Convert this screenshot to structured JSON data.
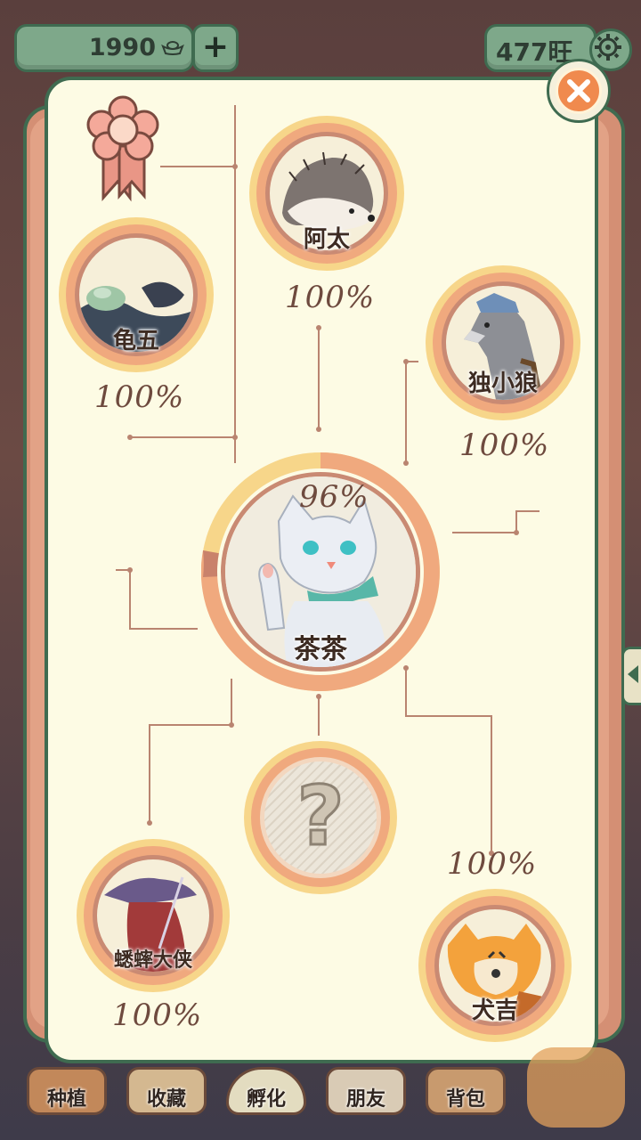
{
  "topbar": {
    "coins": "1990",
    "coin_icon": "ingot-icon",
    "plus_label": "+",
    "wang": "477旺",
    "settings_icon": "gear-icon"
  },
  "ribbon_icon": "flower-ribbon-icon",
  "close_icon": "close-icon",
  "characters": {
    "center": {
      "name": "茶茶",
      "percent": "96%",
      "progress": 0.96
    },
    "top": {
      "name": "阿太",
      "percent": "100%",
      "progress": 1.0
    },
    "upper_left": {
      "name": "龟五",
      "percent": "100%",
      "progress": 1.0
    },
    "upper_right": {
      "name": "独小狼",
      "percent": "100%",
      "progress": 1.0
    },
    "lower_left": {
      "name": "蟋蟀大侠",
      "percent": "100%",
      "progress": 1.0
    },
    "lower_right": {
      "name": "犬吉",
      "percent": "100%",
      "progress": 1.0
    },
    "unknown": {
      "name": "?",
      "locked": true
    }
  },
  "bottom_nav": [
    {
      "label": "种植"
    },
    {
      "label": "收藏"
    },
    {
      "label": "孵化"
    },
    {
      "label": "朋友"
    },
    {
      "label": "背包"
    }
  ],
  "colors": {
    "ring_outer": "#f7d68a",
    "ring_inner": "#f0a97e",
    "card_bg": "#fdfbe4",
    "line": "#b98470",
    "frame": "#3f6b50",
    "close": "#f08a4e"
  }
}
